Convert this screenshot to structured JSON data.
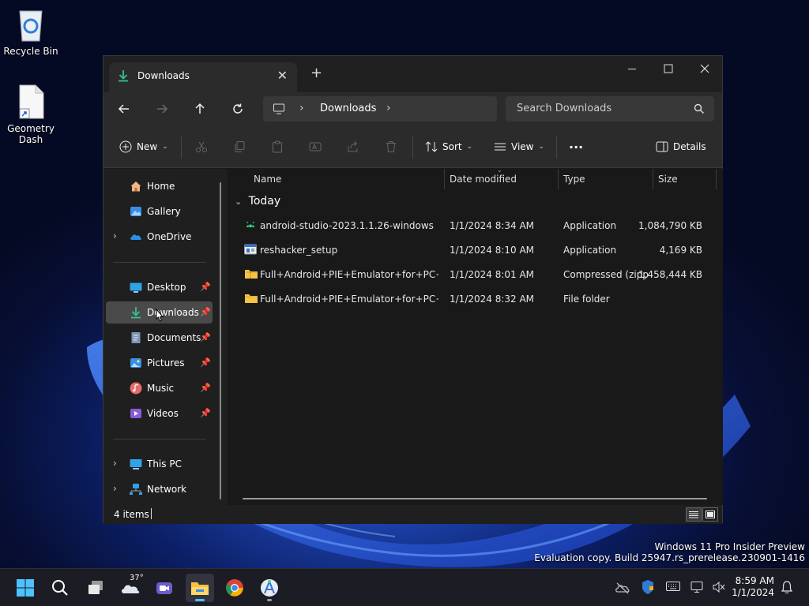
{
  "desktop": {
    "recycle_bin": "Recycle Bin",
    "geometry_dash": "Geometry\nDash"
  },
  "watermark": {
    "line1": "Windows 11 Pro Insider Preview",
    "line2": "Evaluation copy. Build 25947.rs_prerelease.230901-1416"
  },
  "window": {
    "tab_title": "Downloads",
    "tab_close": "✕",
    "new_tab": "+",
    "address": {
      "crumb": "Downloads"
    },
    "search_placeholder": "Search Downloads",
    "commands": {
      "new": "New",
      "sort": "Sort",
      "view": "View",
      "more": "···",
      "details": "Details"
    }
  },
  "nav": {
    "items": [
      {
        "label": "Home"
      },
      {
        "label": "Gallery"
      },
      {
        "label": "OneDrive"
      },
      {
        "label": "Desktop"
      },
      {
        "label": "Downloads"
      },
      {
        "label": "Documents"
      },
      {
        "label": "Pictures"
      },
      {
        "label": "Music"
      },
      {
        "label": "Videos"
      },
      {
        "label": "This PC"
      },
      {
        "label": "Network"
      }
    ],
    "selected": "Downloads"
  },
  "columns": {
    "name": "Name",
    "date": "Date modified",
    "type": "Type",
    "size": "Size"
  },
  "group": {
    "label": "Today"
  },
  "files": [
    {
      "name": "android-studio-2023.1.1.26-windows",
      "date": "1/1/2024 8:34 AM",
      "type": "Application",
      "size": "1,084,790 KB",
      "icon": "android-studio-icon"
    },
    {
      "name": "reshacker_setup",
      "date": "1/1/2024 8:10 AM",
      "type": "Application",
      "size": "4,169 KB",
      "icon": "installer-icon"
    },
    {
      "name": "Full+Android+PIE+Emulator+for+PC+W...",
      "date": "1/1/2024 8:01 AM",
      "type": "Compressed (zipp...",
      "size": "1,458,444 KB",
      "icon": "zip-folder-icon"
    },
    {
      "name": "Full+Android+PIE+Emulator+for+PC+W...",
      "date": "1/1/2024 8:32 AM",
      "type": "File folder",
      "size": "",
      "icon": "folder-icon"
    }
  ],
  "status": {
    "count": "4 items"
  },
  "taskbar": {
    "weather_temp": "37°",
    "time": "8:59 AM",
    "date": "1/1/2024"
  },
  "colors": {
    "accent": "#4cc2ff",
    "window_bg": "#191919",
    "chrome_bg": "#2b2b2b",
    "selected_bg": "#4a4a4a",
    "folder": "#f6c342"
  }
}
